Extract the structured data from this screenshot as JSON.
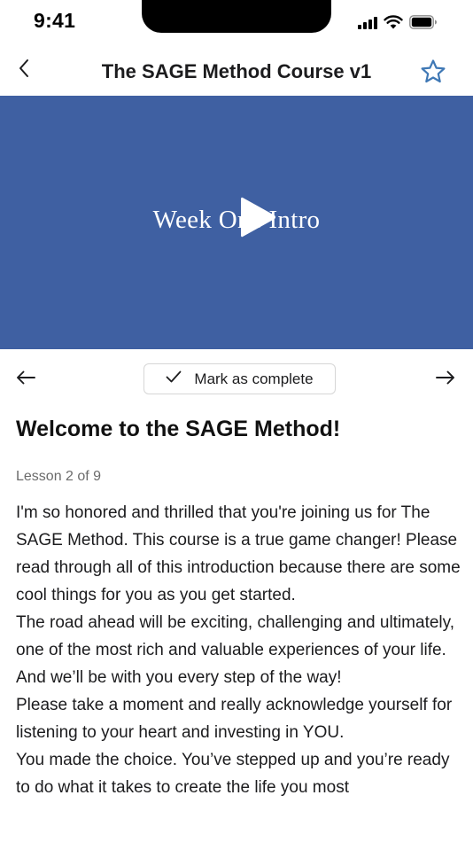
{
  "status_bar": {
    "time": "9:41"
  },
  "nav": {
    "title": "The SAGE Method Course v1",
    "back_icon": "chevron-left-icon",
    "favorite_icon": "star-outline-icon",
    "accent_color": "#3f78b5"
  },
  "video": {
    "title": "Week One Intro",
    "background_color": "#3f60a2",
    "play_icon": "play-icon"
  },
  "lesson_nav": {
    "prev_icon": "arrow-left-icon",
    "next_icon": "arrow-right-icon",
    "complete_label": "Mark as complete",
    "complete_icon": "checkmark-icon"
  },
  "lesson": {
    "heading": "Welcome to the SAGE Method!",
    "counter": "Lesson 2 of 9",
    "paragraphs": [
      "I'm so honored and thrilled that you're joining us for The SAGE Method. This course is a true game changer! Please read through all of this introduction because there are some cool things for you as you get started.",
      "The road ahead will be exciting, challenging and ultimately, one of the most rich and valuable experiences of your life. And we’ll be with you every step of the way!",
      "Please take a moment and really acknowledge yourself for listening to your heart and investing in YOU.",
      "You made the choice. You’ve stepped up and you’re ready to do what it takes to create the life you most"
    ]
  }
}
